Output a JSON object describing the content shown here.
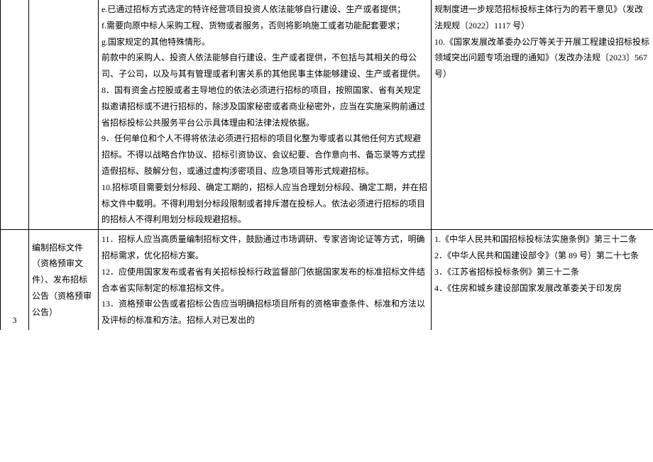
{
  "rows": [
    {
      "num": "",
      "title": "",
      "content": "e.已通过招标方式选定的特许经营项目投资人依法能够自行建设、生产或者提供；\nf.需要向原中标人采购工程、货物或者服务，否则将影响施工或者功能配套要求；\ng.国家规定的其他特殊情形。\n前款中的采购人、投资人依法能够自行建设、生产或者提供，不包括与其相关的母公司、子公司，以及与其有管理或者利害关系的其他民事主体能够建设、生产或者提供。\n8．国有资金占控股或者主导地位的依法必须进行招标的项目，按照国家、省有关规定拟邀请招标或不进行招标的，除涉及国家秘密或者商业秘密外，应当在实施采购前通过省招标投标公共服务平台公示具体理由和法律法规依据。\n9．任何单位和个人不得将依法必须进行招标的项目化整为零或者以其他任何方式规避招标。不得以战略合作协议、招标引资协议、会议纪要、合作意向书、备忘录等方式捏造假招标、肢解分包，或通过虚构涉密项目、应急项目等形式规避招标。\n10.招标项目需要划分标段、确定工期的，招标人应当合理划分标段、确定工期，并在招标文件中载明。不得利用划分标段限制或者排斥潜在投标人。依法必须进行招标的项目的招标人不得利用划分标段规避招标。",
      "ref": "规制度进一步规范招标投标主体行为的若干意见》（发改法规规〔2022〕1117 号）\n10.《国家发展改革委办公厅等关于开展工程建设招标投标领域突出问题专项治理的通知》（发改办法规〔2023〕567 号）"
    },
    {
      "num": "3",
      "title": "编制招标文件（资格预审文件）、发布招标公告（资格预审公告）",
      "content": "11．招标人应当高质量编制招标文件，鼓励通过市场调研、专家咨询论证等方式，明确招标需求，优化招标方案。\n12．应使用国家发布或者省有关招标投标行政监督部门依据国家发布的标准招标文件结合本省实际制定的标准招标文件。\n13．资格预审公告或者招标公告应当明确招标项目所有的资格审查条件、标准和方法以及评标的标准和方法。招标人对已发出的",
      "ref": "1.《中华人民共和国招标投标法实施条例》第三十二条\n2．《中华人民共和国建设部令》（第 89 号）第二十七条\n3．《江苏省招标投标条例》第三十二条\n4．《住房和城乡建设部国家发展改革委关于印发房"
    }
  ]
}
